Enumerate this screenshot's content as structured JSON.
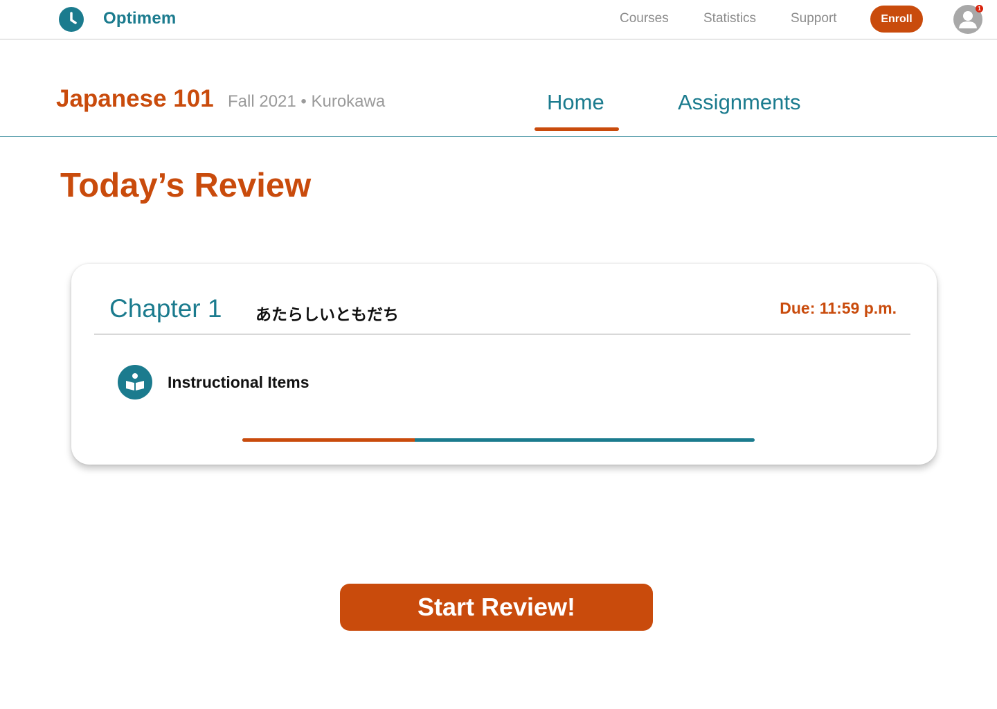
{
  "header": {
    "brand": "Optimem",
    "logo_icon": "clock-icon",
    "nav": [
      {
        "label": "Courses"
      },
      {
        "label": "Statistics"
      },
      {
        "label": "Support"
      }
    ],
    "enroll_label": "Enroll",
    "notification_count": "1",
    "avatar_icon": "user-avatar-icon"
  },
  "course": {
    "title": "Japanese 101",
    "meta": "Fall 2021 • Kurokawa",
    "tabs": [
      {
        "label": "Home",
        "active": true
      },
      {
        "label": "Assignments",
        "active": false
      }
    ]
  },
  "main": {
    "section_title": "Today’s Review",
    "card": {
      "chapter": "Chapter 1",
      "chapter_subtitle": "あたらしいともだち",
      "due": "Due: 11:59 p.m.",
      "item_label": "Instructional Items",
      "item_icon": "book-reader-icon",
      "progress_fraction": 0.336
    },
    "start_label": "Start Review!"
  },
  "colors": {
    "accent_orange": "#c94b0c",
    "accent_teal": "#1b7b8e",
    "muted_gray": "#9a9a9a"
  }
}
